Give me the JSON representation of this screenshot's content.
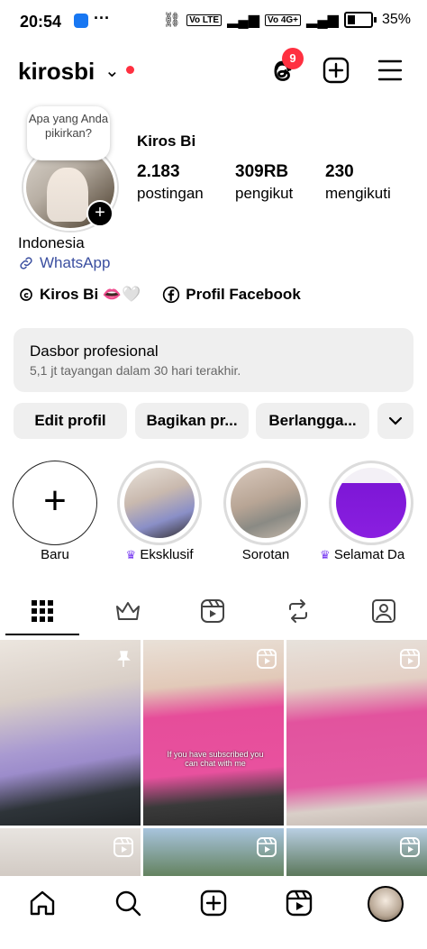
{
  "status_bar": {
    "time": "20:54",
    "dots": "···",
    "sim1": "Vo LTE",
    "sim2": "Vo 4G+",
    "battery": "35%"
  },
  "header": {
    "username": "kirosbi",
    "notification_count": "9"
  },
  "profile": {
    "note_bubble": "Apa yang Anda pikirkan?",
    "name": "Kiros Bi",
    "stats": [
      {
        "value": "2.183",
        "label": "postingan"
      },
      {
        "value": "309RB",
        "label": "pengikut"
      },
      {
        "value": "230",
        "label": "mengikuti"
      }
    ],
    "location": "Indonesia",
    "link": "WhatsApp",
    "threads_handle": "Kiros Bi 👄🤍",
    "facebook": "Profil Facebook"
  },
  "dashboard": {
    "title": "Dasbor profesional",
    "subtitle": "5,1 jt tayangan dalam 30 hari terakhir."
  },
  "buttons": {
    "edit": "Edit profil",
    "share": "Bagikan pr...",
    "subscribe": "Berlangga..."
  },
  "highlights": [
    {
      "label": "Baru"
    },
    {
      "label": "Eksklusif",
      "crown": true
    },
    {
      "label": "Sorotan"
    },
    {
      "label": "Selamat Da",
      "crown": true
    }
  ],
  "grid_caption": "If you have subscribed you can chat with me",
  "colors": {
    "accent_red": "#ff3040",
    "link_blue": "#3b4fa0",
    "crown_purple": "#7b3ff2"
  }
}
